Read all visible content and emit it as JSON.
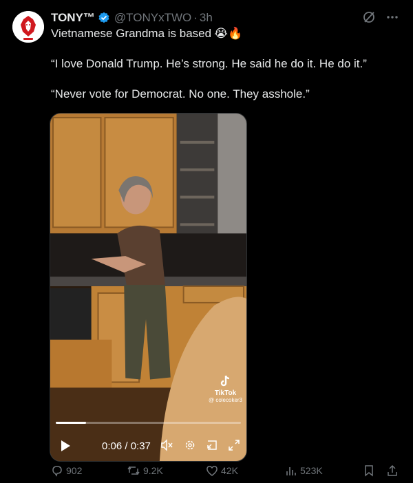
{
  "author": {
    "display_name": "TONY™",
    "handle": "@TONYxTWO",
    "separator": "·",
    "time": "3h",
    "verified_color": "#1d9bf0",
    "avatar_icon": "lion-logo-icon"
  },
  "tweet": {
    "line1": "Vietnamese Grandma is based",
    "emoji": "😭🔥",
    "quote1": "“I love Donald Trump. He’s strong. He said he do it. He do it.”",
    "quote2": "“Never vote for Democrat. No one. They asshole.”"
  },
  "video": {
    "tiktok_label": "TikTok",
    "tiktok_user": "@ colecoker3",
    "timecode": "0:06 / 0:37",
    "progress": 0.162
  },
  "actions": {
    "replies": "902",
    "reposts": "9.2K",
    "likes": "42K",
    "views": "523K"
  },
  "colors": {
    "background": "#000000",
    "text": "#e7e9ea",
    "muted": "#71767b",
    "accent": "#1d9bf0"
  }
}
